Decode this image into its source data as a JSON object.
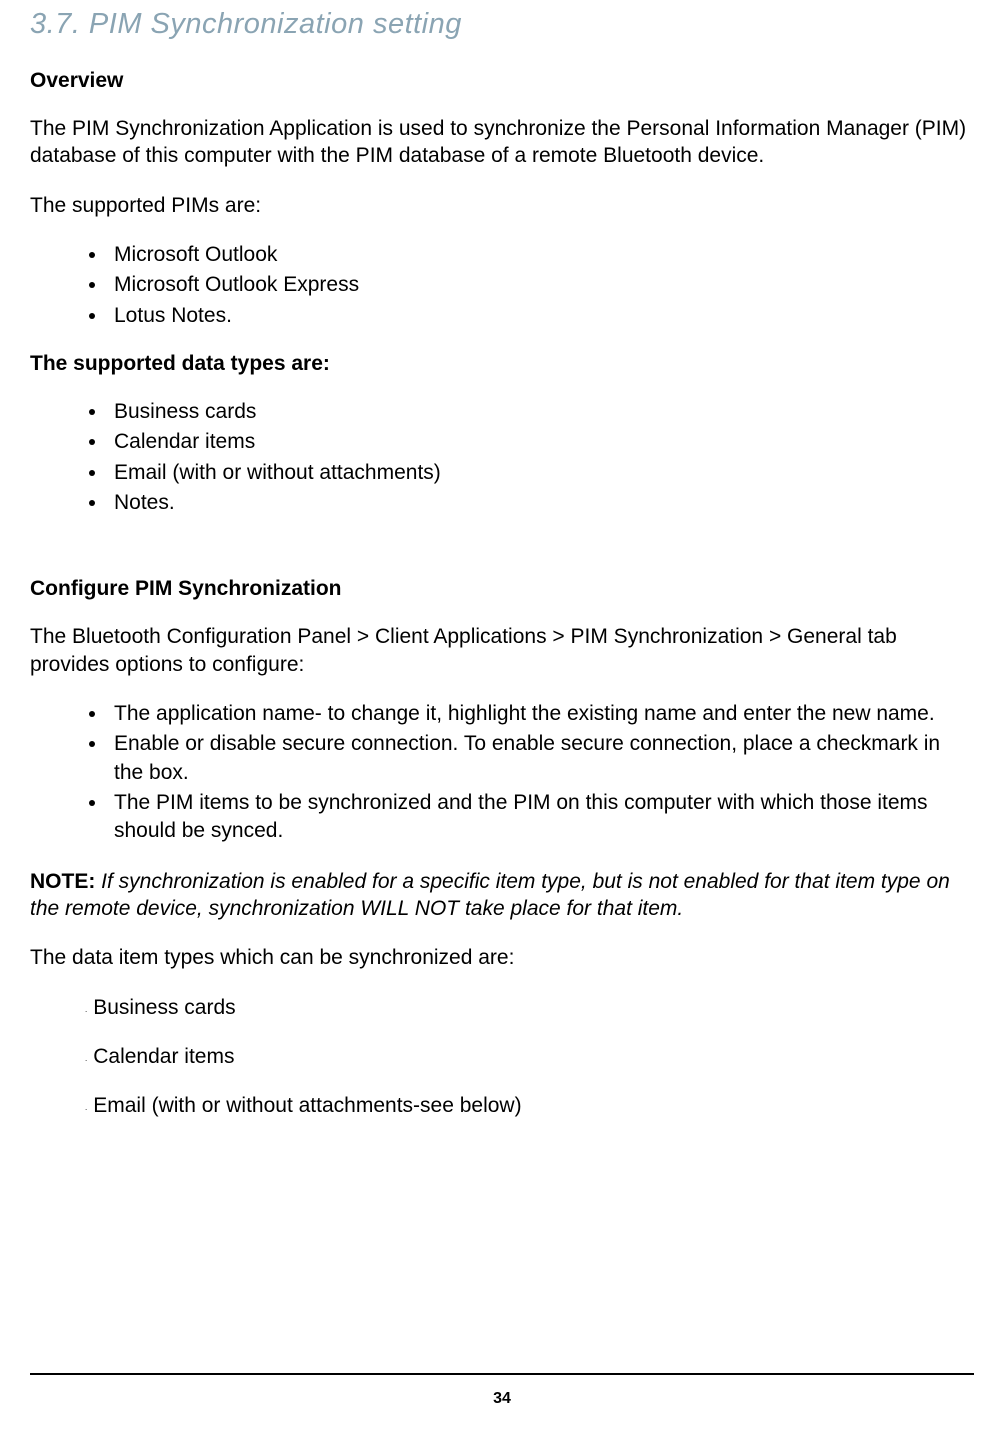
{
  "title": "3.7. PIM Synchronization setting",
  "overview_label": "Overview",
  "overview_text": "The PIM Synchronization Application is used to synchronize the Personal Information Manager (PIM) database of this computer with the PIM database of a remote Bluetooth device.",
  "supported_pims_label": "The supported PIMs are:",
  "supported_pims": [
    "Microsoft Outlook",
    "Microsoft Outlook Express",
    "Lotus Notes."
  ],
  "supported_types_label": "The supported data types are:",
  "supported_types": [
    "Business cards",
    "Calendar items",
    "Email (with or without attachments)",
    "Notes."
  ],
  "configure_label": "Configure PIM Synchronization",
  "configure_intro": "The Bluetooth Configuration Panel > Client Applications > PIM Synchronization > General tab provides options to configure:",
  "configure_options": [
    "The application name- to change it, highlight the existing name and enter the new name.",
    "Enable or disable secure connection. To enable secure connection, place a checkmark in the box.",
    "The PIM items to be synchronized and the PIM on this computer with which those items should be synced."
  ],
  "note_label": "NOTE:",
  "note_text": " If synchronization is enabled for a specific item type, but is not enabled for that item type on the remote device, synchronization WILL NOT take place for that item.",
  "sync_items_label": "The data item types which can be synchronized are:",
  "sync_items": [
    "Business cards",
    "Calendar items",
    "Email (with or without attachments-see below)"
  ],
  "page_number": "34"
}
